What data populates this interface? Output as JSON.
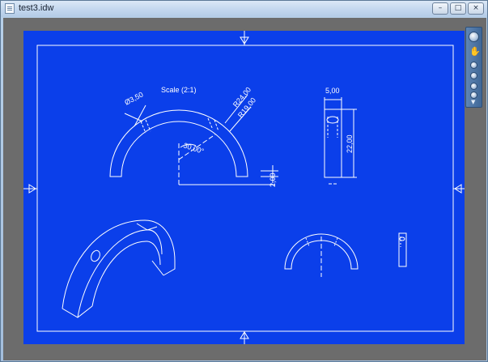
{
  "window": {
    "title": "test3.idw",
    "buttons": {
      "minimize": "–",
      "maximize": "□",
      "close": "×"
    }
  },
  "drawing": {
    "scale_note": "Scale (2:1)",
    "dimensions": {
      "hole_diameter": "Ø3,50",
      "outer_radius": "R24,00",
      "inner_radius": "R19,00",
      "angle": "30,00°",
      "offset": "2,00",
      "width": "5,00",
      "height": "22,00"
    },
    "colors": {
      "sheet": "#0b3fea",
      "lines": "#ffffff",
      "background": "#6c6c6c"
    }
  },
  "navigation_bar": {
    "tools": [
      "steering-wheel-icon",
      "pan-hand-icon",
      "zoom-icon",
      "orbit-icon",
      "look-icon",
      "rewind-icon"
    ],
    "hand_glyph": "✋",
    "caret_glyph": "▼"
  }
}
